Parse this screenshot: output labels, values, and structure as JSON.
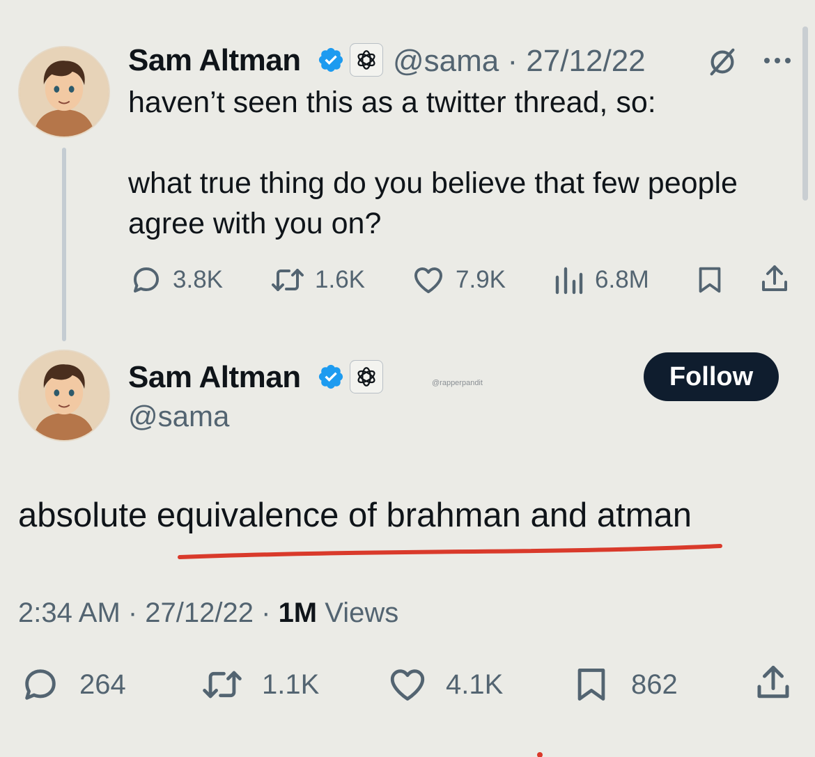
{
  "parent_tweet": {
    "author_name": "Sam Altman",
    "handle_date": "@sama · 27/12/22",
    "text_line1": "haven’t seen this as a twitter thread, so:",
    "text_line2": "what true thing do you believe that few people",
    "text_line3": "agree with you on?",
    "replies": "3.8K",
    "retweets": "1.6K",
    "likes": "7.9K",
    "views": "6.8M"
  },
  "main_tweet": {
    "author_name": "Sam Altman",
    "handle": "@sama",
    "follow_label": "Follow",
    "watermark": "@rapperpandit",
    "text": "absolute equivalence of brahman and atman",
    "time_date": "2:34 AM · 27/12/22 · ",
    "views_count": "1M",
    "views_label": " Views",
    "replies": "264",
    "retweets": "1.1K",
    "likes": "4.1K",
    "bookmarks": "862"
  },
  "colors": {
    "background": "#ebebe6",
    "verified_blue": "#1d9bf0",
    "underline_red": "#d93a2b",
    "follow_button": "#0f1d2e",
    "secondary_text": "#536471"
  },
  "icons": [
    "verified-badge-icon",
    "openai-logo-icon",
    "grok-icon",
    "more-icon",
    "reply-icon",
    "retweet-icon",
    "like-icon",
    "views-icon",
    "bookmark-icon",
    "share-icon"
  ]
}
